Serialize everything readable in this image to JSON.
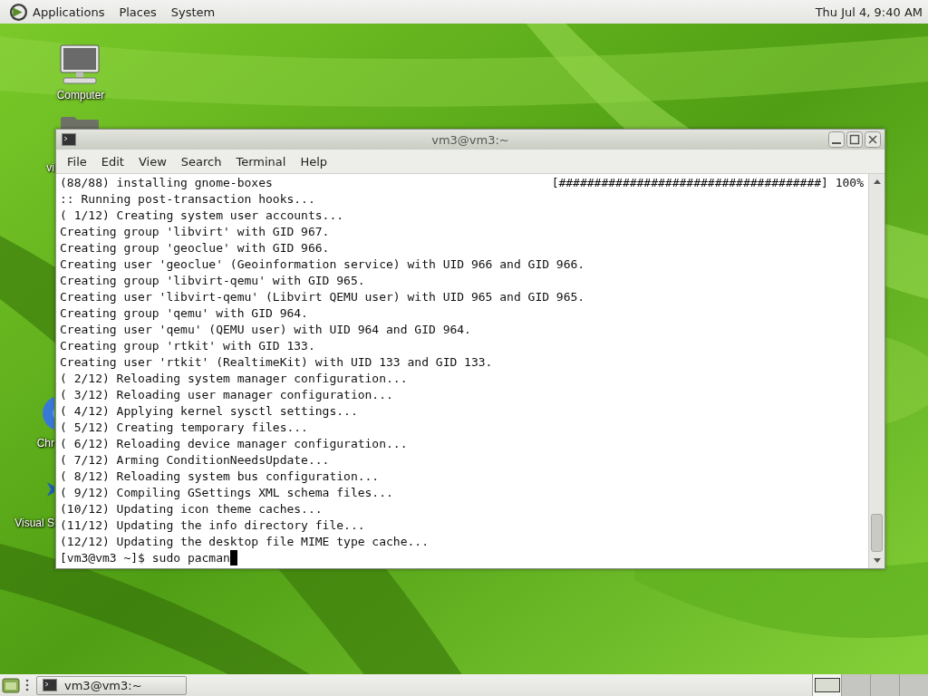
{
  "top_panel": {
    "menus": [
      {
        "label": "Applications"
      },
      {
        "label": "Places"
      },
      {
        "label": "System"
      }
    ],
    "clock": "Thu Jul 4, 9:40 AM"
  },
  "desktop_icons": [
    {
      "label": "Computer",
      "kind": "computer"
    },
    {
      "label": "vi",
      "kind": "folder"
    },
    {
      "label": "Chr",
      "kind": "browser"
    },
    {
      "label": "Visual S",
      "kind": "editor"
    }
  ],
  "terminal": {
    "title": "vm3@vm3:~",
    "menus": [
      "File",
      "Edit",
      "View",
      "Search",
      "Terminal",
      "Help"
    ],
    "progress": "[#####################################] 100%",
    "lines": [
      "(88/88) installing gnome-boxes",
      ":: Running post-transaction hooks...",
      "( 1/12) Creating system user accounts...",
      "Creating group 'libvirt' with GID 967.",
      "Creating group 'geoclue' with GID 966.",
      "Creating user 'geoclue' (Geoinformation service) with UID 966 and GID 966.",
      "Creating group 'libvirt-qemu' with GID 965.",
      "Creating user 'libvirt-qemu' (Libvirt QEMU user) with UID 965 and GID 965.",
      "Creating group 'qemu' with GID 964.",
      "Creating user 'qemu' (QEMU user) with UID 964 and GID 964.",
      "Creating group 'rtkit' with GID 133.",
      "Creating user 'rtkit' (RealtimeKit) with UID 133 and GID 133.",
      "( 2/12) Reloading system manager configuration...",
      "( 3/12) Reloading user manager configuration...",
      "( 4/12) Applying kernel sysctl settings...",
      "( 5/12) Creating temporary files...",
      "( 6/12) Reloading device manager configuration...",
      "( 7/12) Arming ConditionNeedsUpdate...",
      "( 8/12) Reloading system bus configuration...",
      "( 9/12) Compiling GSettings XML schema files...",
      "(10/12) Updating icon theme caches...",
      "(11/12) Updating the info directory file...",
      "(12/12) Updating the desktop file MIME type cache..."
    ],
    "prompt": "[vm3@vm3 ~]$ sudo pacman"
  },
  "taskbar": {
    "windows": [
      {
        "label": "vm3@vm3:~",
        "selected": false
      }
    ],
    "workspaces": [
      {
        "selected": true
      },
      {
        "selected": false
      },
      {
        "selected": false
      },
      {
        "selected": false
      }
    ]
  }
}
